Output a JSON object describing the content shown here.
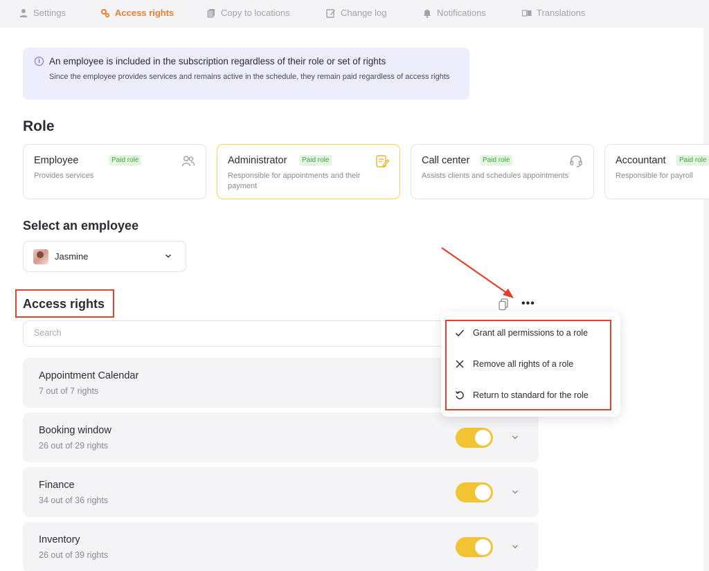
{
  "tabs": [
    {
      "label": "Settings",
      "icon": "user-icon"
    },
    {
      "label": "Access rights",
      "icon": "gears-icon",
      "active": true
    },
    {
      "label": "Copy to locations",
      "icon": "copy-icon"
    },
    {
      "label": "Change log",
      "icon": "edit-icon"
    },
    {
      "label": "Notifications",
      "icon": "bell-icon"
    },
    {
      "label": "Translations",
      "icon": "translate-icon"
    }
  ],
  "banner": {
    "title": "An employee is included in the subscription regardless of their role or set of rights",
    "text": "Since the employee provides services and remains active in the schedule, they remain paid regardless of access rights"
  },
  "role_section": {
    "heading": "Role",
    "roles": [
      {
        "name": "Employee",
        "badge": "Paid role",
        "desc": "Provides services",
        "icon": "users-icon"
      },
      {
        "name": "Administrator",
        "badge": "Paid role",
        "desc": "Responsible for appointments and their payment",
        "icon": "notepad-edit-icon",
        "selected": true
      },
      {
        "name": "Call center",
        "badge": "Paid role",
        "desc": "Assists clients and schedules appointments",
        "icon": "headset-icon"
      },
      {
        "name": "Accountant",
        "badge": "Paid role",
        "desc": "Responsible for payroll",
        "icon": ""
      }
    ]
  },
  "employee_section": {
    "heading": "Select an employee",
    "selected": "Jasmine"
  },
  "access_rights": {
    "heading": "Access rights",
    "search_placeholder": "Search",
    "rows": [
      {
        "name": "Appointment Calendar",
        "count": "7 out of 7 rights",
        "enabled": true
      },
      {
        "name": "Booking window",
        "count": "26 out of 29 rights",
        "enabled": true
      },
      {
        "name": "Finance",
        "count": "34 out of 36 rights",
        "enabled": true
      },
      {
        "name": "Inventory",
        "count": "26 out of 39 rights",
        "enabled": true
      }
    ]
  },
  "menu": {
    "items": [
      {
        "label": "Grant all permissions to a role",
        "icon": "check-icon"
      },
      {
        "label": "Remove all rights of a role",
        "icon": "x-icon"
      },
      {
        "label": "Return to standard for the role",
        "icon": "reset-icon"
      }
    ]
  },
  "colors": {
    "accent": "#f07f2d",
    "toggle": "#f2c434",
    "badge_bg": "#e3f6e2",
    "badge_text": "#43a43c",
    "annotation": "#e0412b",
    "banner_bg": "#eeedfb"
  }
}
